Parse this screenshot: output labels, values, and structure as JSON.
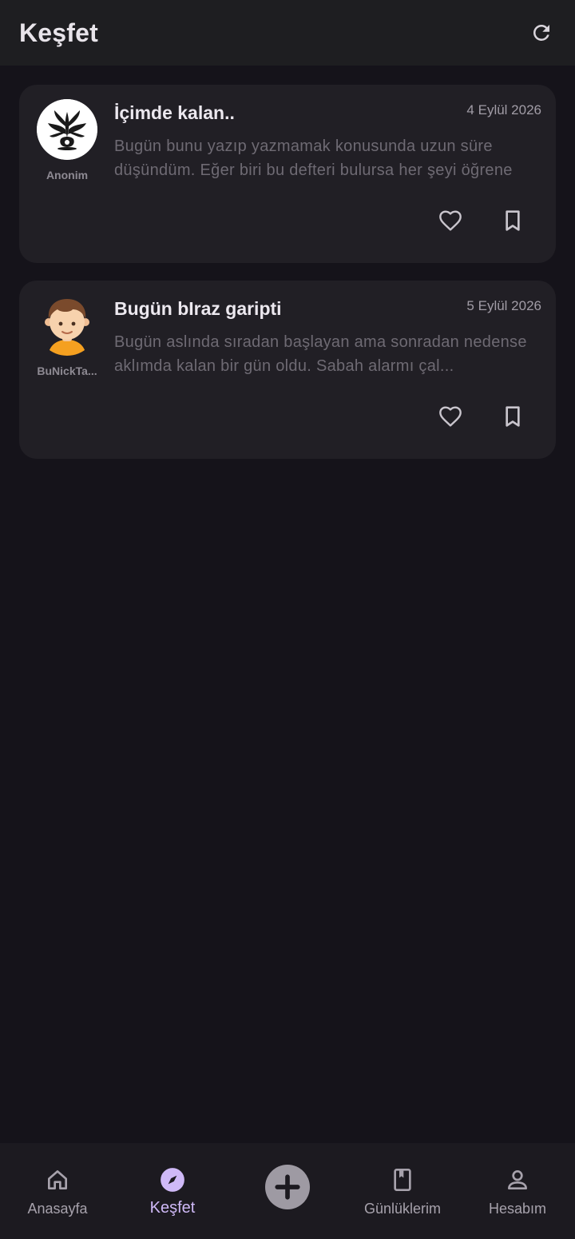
{
  "appbar": {
    "title": "Keşfet",
    "refresh_icon": "refresh-icon"
  },
  "feed": {
    "posts": [
      {
        "title": "İçimde kalan..",
        "date": "4 Eylül 2026",
        "author": "Anonim",
        "excerpt": "Bugün bunu yazıp yazmamak konusunda uzun süre düşündüm. Eğer biri bu defteri bulursa her şeyi öğrene"
      },
      {
        "title": "Bugün bIraz garipti",
        "date": "5 Eylül 2026",
        "author": "BuNickTa...",
        "excerpt": "Bugün aslında sıradan başlayan ama sonradan nedense aklımda kalan bir gün oldu. Sabah alarmı çal..."
      }
    ]
  },
  "bottomnav": {
    "items": [
      {
        "label": "Anasayfa",
        "icon": "home-icon"
      },
      {
        "label": "Keşfet",
        "icon": "compass-icon",
        "active": true
      },
      {
        "label": "",
        "icon": "add-icon"
      },
      {
        "label": "Günlüklerim",
        "icon": "book-icon"
      },
      {
        "label": "Hesabım",
        "icon": "person-icon"
      }
    ]
  },
  "colors": {
    "background": "#15131a",
    "card": "#211f25",
    "accent": "#cfb9f7"
  }
}
